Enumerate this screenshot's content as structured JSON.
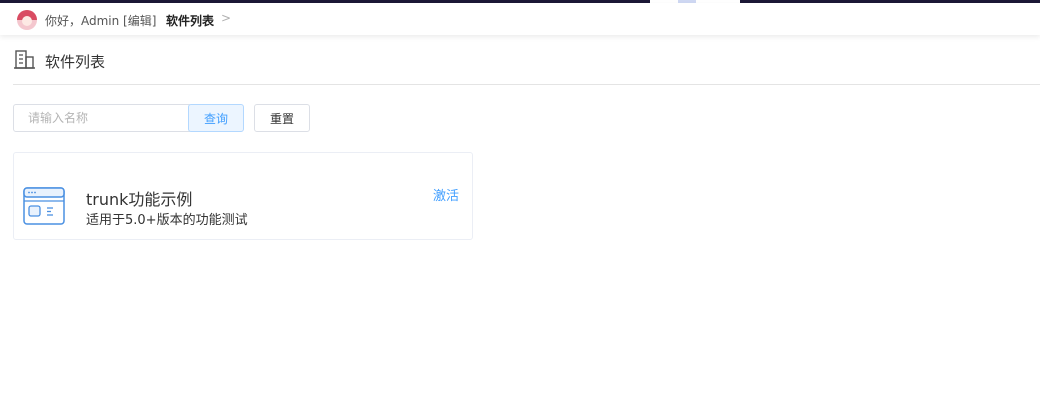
{
  "header": {
    "greeting": "你好，Admin [编辑]",
    "breadcrumb": "软件列表",
    "chevron": ">"
  },
  "page": {
    "title": "软件列表"
  },
  "search": {
    "placeholder": "请输入名称",
    "value": "",
    "query_label": "查询",
    "reset_label": "重置"
  },
  "software": [
    {
      "name": "trunk功能示例",
      "description": "适用于5.0+版本的功能测试",
      "action": "激活"
    }
  ],
  "colors": {
    "accent": "#409eff",
    "top_strip": "#1c1836",
    "avatar": "#d94b62"
  },
  "icons": {
    "page": "building-icon",
    "app": "app-window-icon",
    "breadcrumb_separator": "chevron-right-icon"
  }
}
